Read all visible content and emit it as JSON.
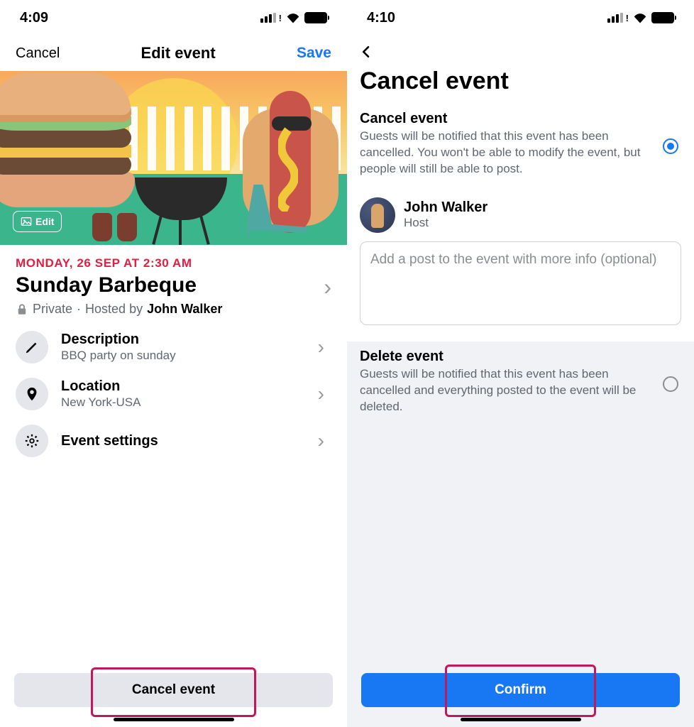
{
  "colors": {
    "accent_blue": "#1877F2",
    "highlight": "#c2185b",
    "date_red": "#e41e3f"
  },
  "left": {
    "status_time": "4:09",
    "header": {
      "cancel": "Cancel",
      "title": "Edit event",
      "save": "Save"
    },
    "cover_edit": "Edit",
    "date_line": "MONDAY, 26 SEP AT 2:30 AM",
    "title": "Sunday Barbeque",
    "privacy": "Private",
    "hosted_by_prefix": "Hosted by",
    "host_name": "John Walker",
    "rows": {
      "description": {
        "title": "Description",
        "sub": "BBQ party on sunday"
      },
      "location": {
        "title": "Location",
        "sub": "New York-USA"
      },
      "settings": {
        "title": "Event settings"
      }
    },
    "cta": "Cancel event"
  },
  "right": {
    "status_time": "4:10",
    "title": "Cancel event",
    "options": {
      "cancel": {
        "title": "Cancel event",
        "desc": "Guests will be notified that this event has been cancelled. You won't be able to modify the event, but people will still be able to post."
      },
      "delete": {
        "title": "Delete event",
        "desc": "Guests will be notified that this event has been cancelled and everything posted to the event will be deleted."
      }
    },
    "host": {
      "name": "John Walker",
      "role": "Host",
      "placeholder": "Add a post to the event with more info (optional)"
    },
    "cta": "Confirm"
  }
}
